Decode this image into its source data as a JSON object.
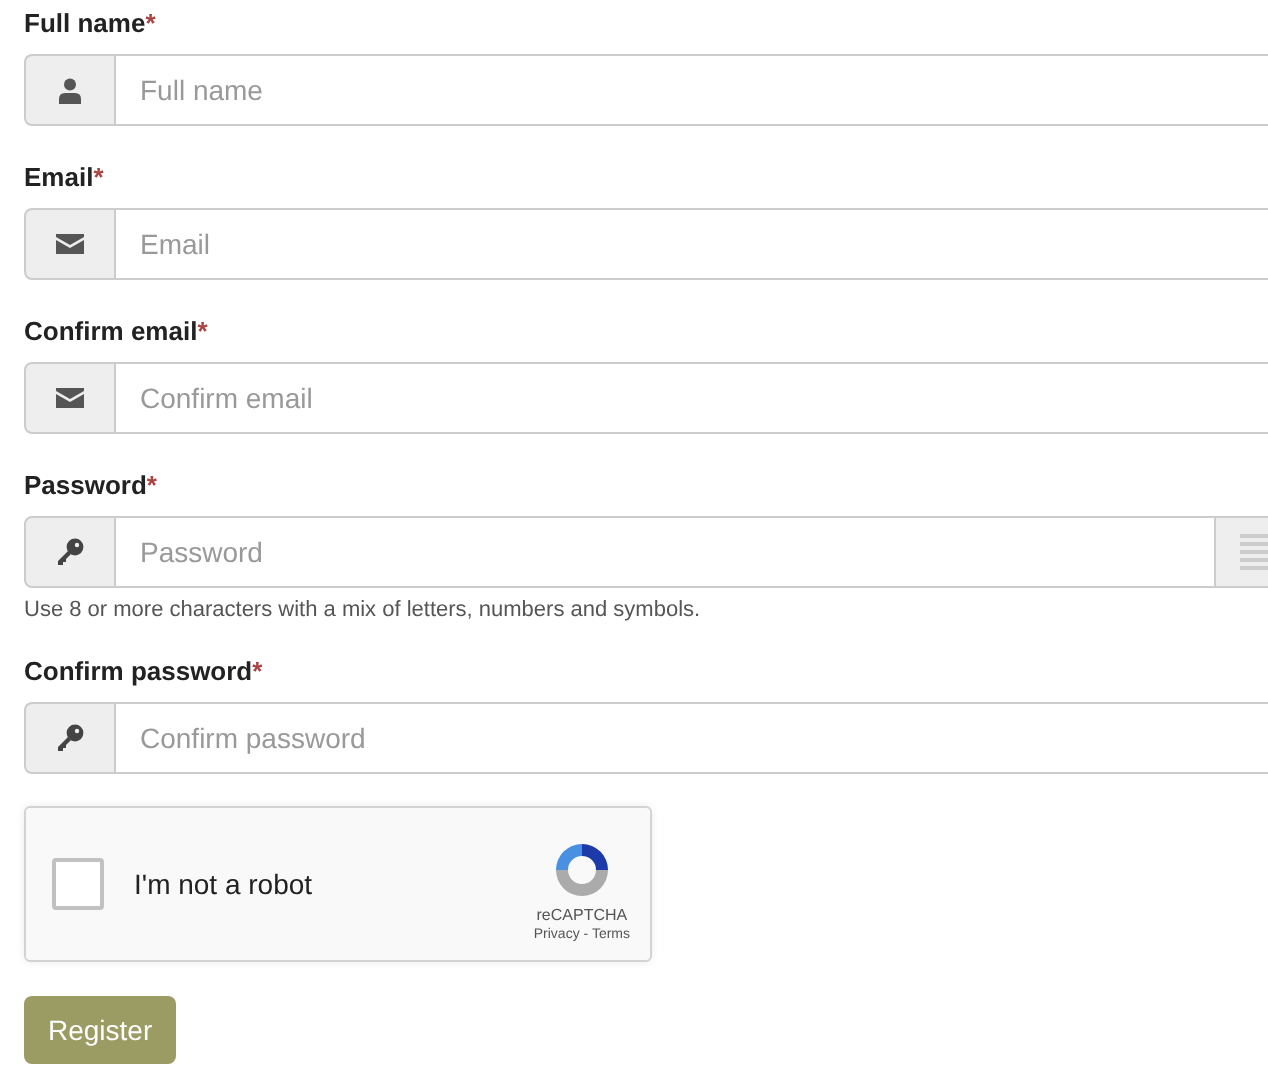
{
  "fields": [
    {
      "kind": "name",
      "label": "Full name",
      "required_mark": "*",
      "placeholder": "Full name"
    },
    {
      "kind": "email",
      "label": "Email",
      "required_mark": "*",
      "placeholder": "Email"
    },
    {
      "kind": "email",
      "label": "Confirm email",
      "required_mark": "*",
      "placeholder": "Confirm email"
    },
    {
      "kind": "password",
      "label": "Password",
      "required_mark": "*",
      "placeholder": "Password",
      "help": "Use 8 or more characters with a mix of letters, numbers and symbols."
    },
    {
      "kind": "password_confirm",
      "label": "Confirm password",
      "required_mark": "*",
      "placeholder": "Confirm password"
    }
  ],
  "captcha": {
    "checked": false,
    "label": "I'm not a robot",
    "brand": "reCAPTCHA",
    "privacy": "Privacy",
    "separator": " - ",
    "terms": "Terms"
  },
  "submit": "Register"
}
